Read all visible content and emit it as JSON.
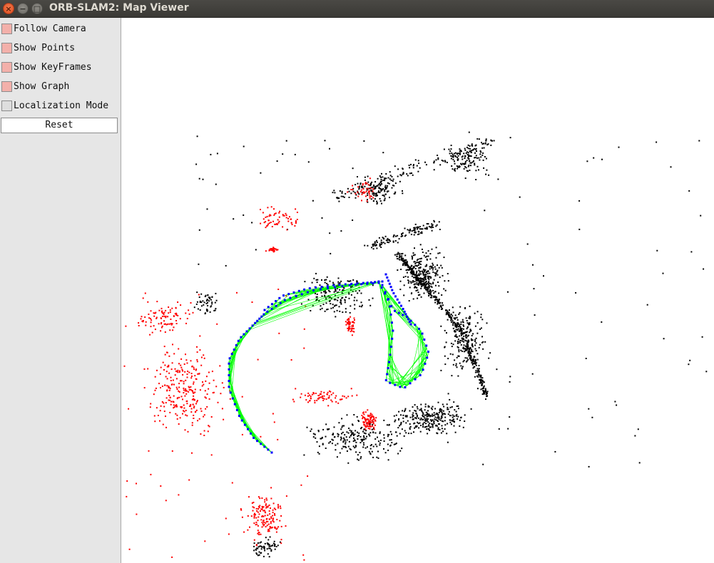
{
  "window": {
    "title": "ORB-SLAM2: Map Viewer",
    "buttons": {
      "close": "×",
      "minimize": "−",
      "maximize": "□"
    }
  },
  "panel": {
    "options": [
      {
        "label": "Follow Camera",
        "checked": true
      },
      {
        "label": "Show Points",
        "checked": true
      },
      {
        "label": "Show KeyFrames",
        "checked": true
      },
      {
        "label": "Show Graph",
        "checked": true
      },
      {
        "label": "Localization Mode",
        "checked": false
      }
    ],
    "reset_label": "Reset"
  },
  "colors": {
    "checked_box": "#f3b0aa",
    "unchecked_box": "#dedede",
    "panel_background": "#e6e6e6",
    "map_points": "#000000",
    "reference_points": "#ff0000",
    "keyframes": "#0000ff",
    "covisibility_graph": "#00ff00"
  }
}
